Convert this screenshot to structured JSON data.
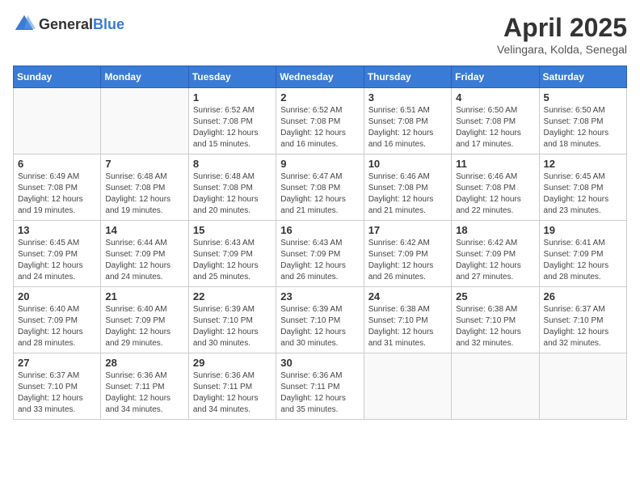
{
  "header": {
    "logo_general": "General",
    "logo_blue": "Blue",
    "title": "April 2025",
    "location": "Velingara, Kolda, Senegal"
  },
  "calendar": {
    "days_of_week": [
      "Sunday",
      "Monday",
      "Tuesday",
      "Wednesday",
      "Thursday",
      "Friday",
      "Saturday"
    ],
    "weeks": [
      [
        {
          "day": "",
          "info": ""
        },
        {
          "day": "",
          "info": ""
        },
        {
          "day": "1",
          "info": "Sunrise: 6:52 AM\nSunset: 7:08 PM\nDaylight: 12 hours and 15 minutes."
        },
        {
          "day": "2",
          "info": "Sunrise: 6:52 AM\nSunset: 7:08 PM\nDaylight: 12 hours and 16 minutes."
        },
        {
          "day": "3",
          "info": "Sunrise: 6:51 AM\nSunset: 7:08 PM\nDaylight: 12 hours and 16 minutes."
        },
        {
          "day": "4",
          "info": "Sunrise: 6:50 AM\nSunset: 7:08 PM\nDaylight: 12 hours and 17 minutes."
        },
        {
          "day": "5",
          "info": "Sunrise: 6:50 AM\nSunset: 7:08 PM\nDaylight: 12 hours and 18 minutes."
        }
      ],
      [
        {
          "day": "6",
          "info": "Sunrise: 6:49 AM\nSunset: 7:08 PM\nDaylight: 12 hours and 19 minutes."
        },
        {
          "day": "7",
          "info": "Sunrise: 6:48 AM\nSunset: 7:08 PM\nDaylight: 12 hours and 19 minutes."
        },
        {
          "day": "8",
          "info": "Sunrise: 6:48 AM\nSunset: 7:08 PM\nDaylight: 12 hours and 20 minutes."
        },
        {
          "day": "9",
          "info": "Sunrise: 6:47 AM\nSunset: 7:08 PM\nDaylight: 12 hours and 21 minutes."
        },
        {
          "day": "10",
          "info": "Sunrise: 6:46 AM\nSunset: 7:08 PM\nDaylight: 12 hours and 21 minutes."
        },
        {
          "day": "11",
          "info": "Sunrise: 6:46 AM\nSunset: 7:08 PM\nDaylight: 12 hours and 22 minutes."
        },
        {
          "day": "12",
          "info": "Sunrise: 6:45 AM\nSunset: 7:08 PM\nDaylight: 12 hours and 23 minutes."
        }
      ],
      [
        {
          "day": "13",
          "info": "Sunrise: 6:45 AM\nSunset: 7:09 PM\nDaylight: 12 hours and 24 minutes."
        },
        {
          "day": "14",
          "info": "Sunrise: 6:44 AM\nSunset: 7:09 PM\nDaylight: 12 hours and 24 minutes."
        },
        {
          "day": "15",
          "info": "Sunrise: 6:43 AM\nSunset: 7:09 PM\nDaylight: 12 hours and 25 minutes."
        },
        {
          "day": "16",
          "info": "Sunrise: 6:43 AM\nSunset: 7:09 PM\nDaylight: 12 hours and 26 minutes."
        },
        {
          "day": "17",
          "info": "Sunrise: 6:42 AM\nSunset: 7:09 PM\nDaylight: 12 hours and 26 minutes."
        },
        {
          "day": "18",
          "info": "Sunrise: 6:42 AM\nSunset: 7:09 PM\nDaylight: 12 hours and 27 minutes."
        },
        {
          "day": "19",
          "info": "Sunrise: 6:41 AM\nSunset: 7:09 PM\nDaylight: 12 hours and 28 minutes."
        }
      ],
      [
        {
          "day": "20",
          "info": "Sunrise: 6:40 AM\nSunset: 7:09 PM\nDaylight: 12 hours and 28 minutes."
        },
        {
          "day": "21",
          "info": "Sunrise: 6:40 AM\nSunset: 7:09 PM\nDaylight: 12 hours and 29 minutes."
        },
        {
          "day": "22",
          "info": "Sunrise: 6:39 AM\nSunset: 7:10 PM\nDaylight: 12 hours and 30 minutes."
        },
        {
          "day": "23",
          "info": "Sunrise: 6:39 AM\nSunset: 7:10 PM\nDaylight: 12 hours and 30 minutes."
        },
        {
          "day": "24",
          "info": "Sunrise: 6:38 AM\nSunset: 7:10 PM\nDaylight: 12 hours and 31 minutes."
        },
        {
          "day": "25",
          "info": "Sunrise: 6:38 AM\nSunset: 7:10 PM\nDaylight: 12 hours and 32 minutes."
        },
        {
          "day": "26",
          "info": "Sunrise: 6:37 AM\nSunset: 7:10 PM\nDaylight: 12 hours and 32 minutes."
        }
      ],
      [
        {
          "day": "27",
          "info": "Sunrise: 6:37 AM\nSunset: 7:10 PM\nDaylight: 12 hours and 33 minutes."
        },
        {
          "day": "28",
          "info": "Sunrise: 6:36 AM\nSunset: 7:11 PM\nDaylight: 12 hours and 34 minutes."
        },
        {
          "day": "29",
          "info": "Sunrise: 6:36 AM\nSunset: 7:11 PM\nDaylight: 12 hours and 34 minutes."
        },
        {
          "day": "30",
          "info": "Sunrise: 6:36 AM\nSunset: 7:11 PM\nDaylight: 12 hours and 35 minutes."
        },
        {
          "day": "",
          "info": ""
        },
        {
          "day": "",
          "info": ""
        },
        {
          "day": "",
          "info": ""
        }
      ]
    ]
  }
}
